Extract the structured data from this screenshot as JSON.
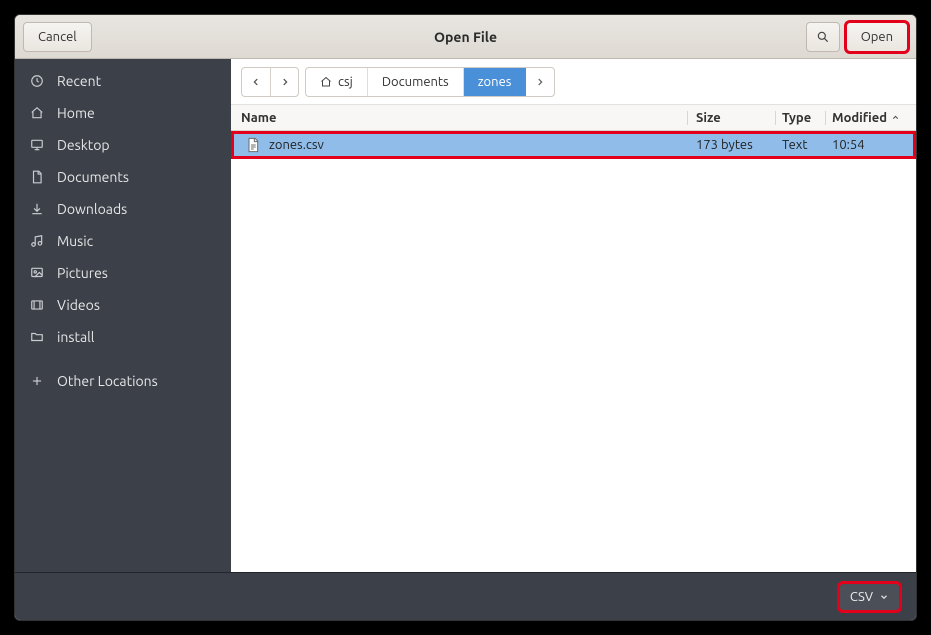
{
  "titlebar": {
    "cancel": "Cancel",
    "title": "Open File",
    "open": "Open"
  },
  "sidebar": {
    "items": [
      {
        "label": "Recent",
        "icon": "clock-icon"
      },
      {
        "label": "Home",
        "icon": "home-icon"
      },
      {
        "label": "Desktop",
        "icon": "desktop-icon"
      },
      {
        "label": "Documents",
        "icon": "document-icon"
      },
      {
        "label": "Downloads",
        "icon": "download-icon"
      },
      {
        "label": "Music",
        "icon": "music-icon"
      },
      {
        "label": "Pictures",
        "icon": "picture-icon"
      },
      {
        "label": "Videos",
        "icon": "video-icon"
      },
      {
        "label": "install",
        "icon": "folder-icon"
      }
    ],
    "other": {
      "label": "Other Locations",
      "icon": "plus-icon"
    }
  },
  "breadcrumbs": {
    "items": [
      {
        "label": "csj",
        "hasHome": true
      },
      {
        "label": "Documents"
      },
      {
        "label": "zones",
        "active": true
      }
    ]
  },
  "columns": {
    "name": "Name",
    "size": "Size",
    "type": "Type",
    "modified": "Modified"
  },
  "files": [
    {
      "name": "zones.csv",
      "size": "173 bytes",
      "type": "Text",
      "modified": "10:54",
      "selected": true
    }
  ],
  "footer": {
    "filter": "CSV"
  }
}
